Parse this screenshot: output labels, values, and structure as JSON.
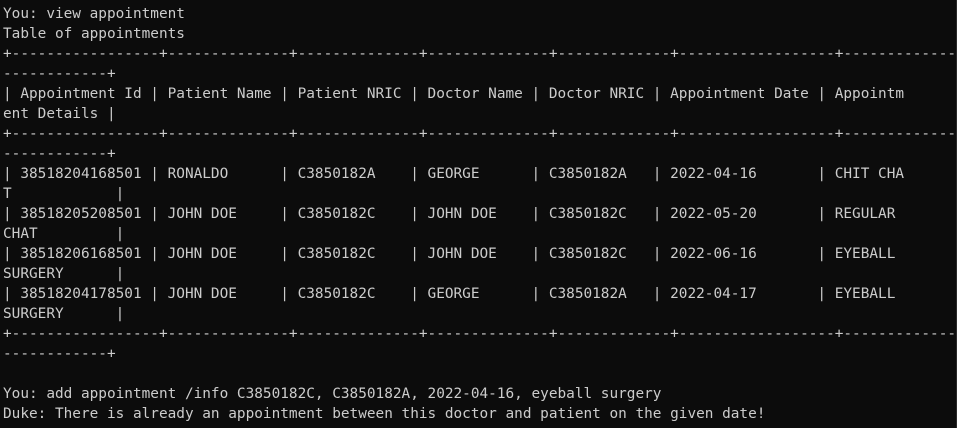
{
  "terminal": {
    "lines": [
      "You: view appointment",
      "Table of appointments",
      "+-----------------+--------------+--------------+--------------+-------------+------------------+--------------",
      "------------+",
      "| Appointment Id | Patient Name | Patient NRIC | Doctor Name | Doctor NRIC | Appointment Date | Appointm",
      "ent Details |",
      "+-----------------+--------------+--------------+--------------+-------------+------------------+--------------",
      "------------+",
      "| 38518204168501 | RONALDO      | C3850182A    | GEORGE      | C3850182A   | 2022-04-16       | CHIT CHA",
      "T            |",
      "| 38518205208501 | JOHN DOE     | C3850182C    | JOHN DOE    | C3850182C   | 2022-05-20       | REGULAR",
      "CHAT         |",
      "| 38518206168501 | JOHN DOE     | C3850182C    | JOHN DOE    | C3850182C   | 2022-06-16       | EYEBALL",
      "SURGERY      |",
      "| 38518204178501 | JOHN DOE     | C3850182C    | GEORGE      | C3850182A   | 2022-04-17       | EYEBALL",
      "SURGERY      |",
      "+-----------------+--------------+--------------+--------------+-------------+------------------+--------------",
      "------------+",
      "",
      "You: add appointment /info C3850182C, C3850182A, 2022-04-16, eyeball surgery",
      "Duke: There is already an appointment between this doctor and patient on the given date!"
    ]
  }
}
